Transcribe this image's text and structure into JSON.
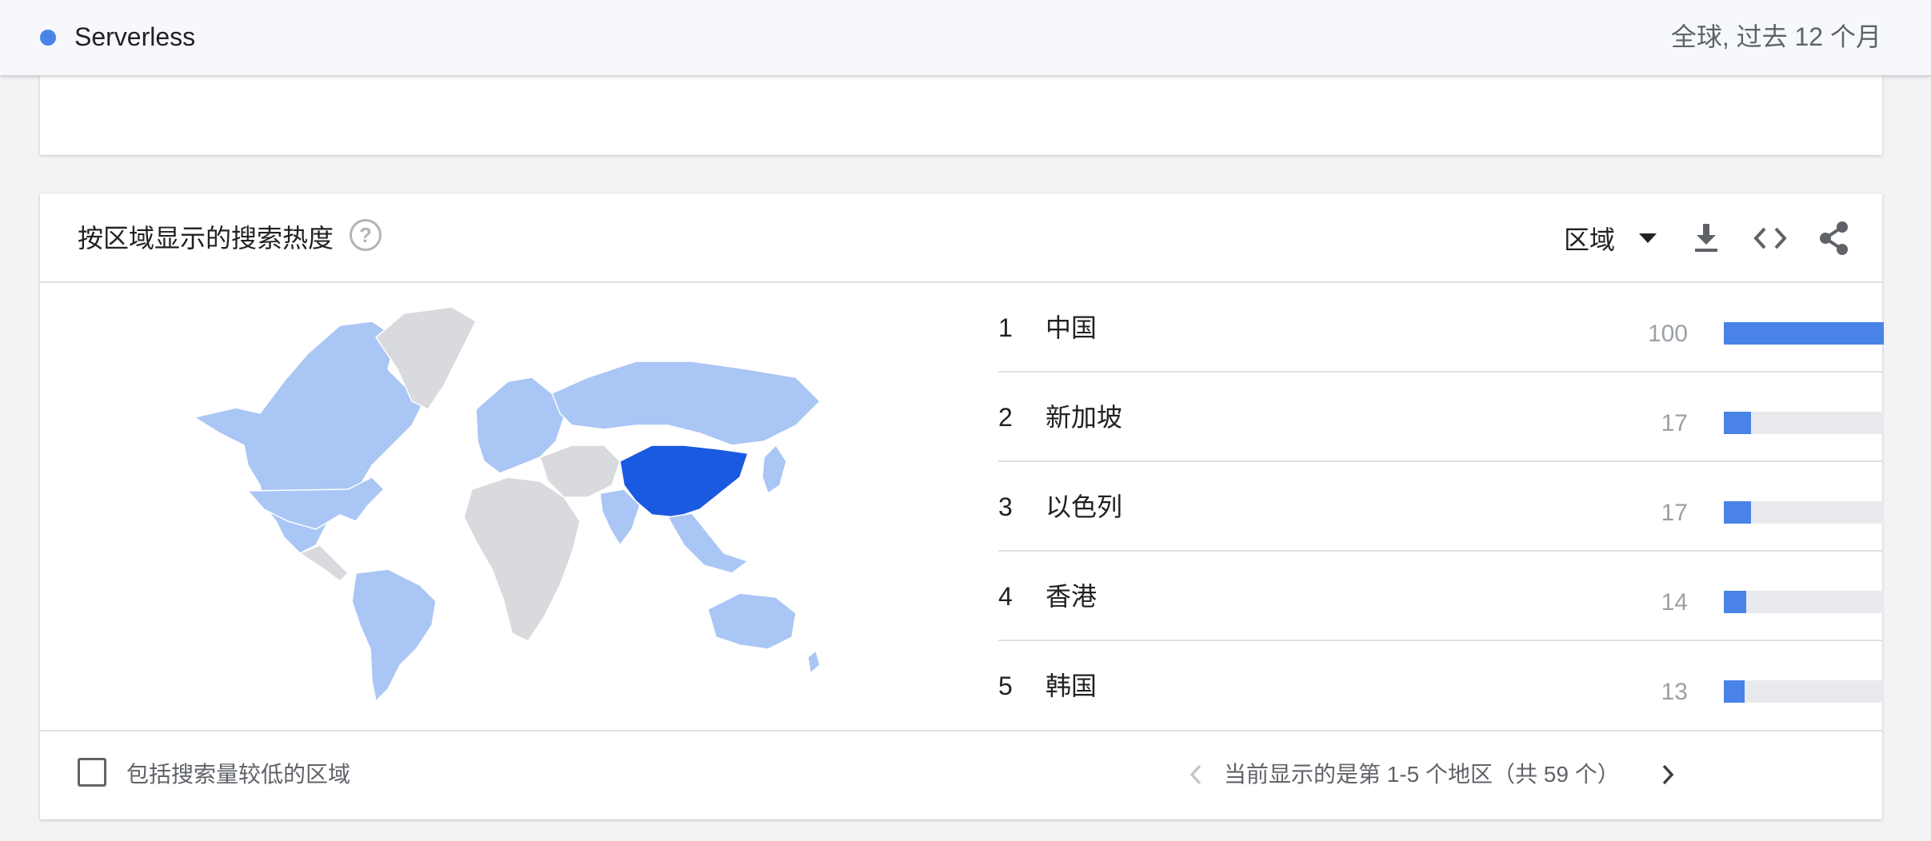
{
  "topbar": {
    "term": "Serverless",
    "scope": "全球, 过去 12 个月",
    "term_color": "#4a83e8"
  },
  "card": {
    "title": "按区域显示的搜索热度",
    "help_icon": "help-circle-icon",
    "region_select": "区域",
    "icons": [
      "download-icon",
      "embed-code-icon",
      "share-icon"
    ]
  },
  "map": {
    "colors": {
      "max": "#1a5ae0",
      "some": "#a9c6f5",
      "none": "#d8dadd"
    }
  },
  "ranking": {
    "rows": [
      {
        "rank": "1",
        "region": "中国",
        "value": "100",
        "fraction": 1.0
      },
      {
        "rank": "2",
        "region": "新加坡",
        "value": "17",
        "fraction": 0.17
      },
      {
        "rank": "3",
        "region": "以色列",
        "value": "17",
        "fraction": 0.17
      },
      {
        "rank": "4",
        "region": "香港",
        "value": "14",
        "fraction": 0.14
      },
      {
        "rank": "5",
        "region": "韩国",
        "value": "13",
        "fraction": 0.13
      }
    ]
  },
  "footer": {
    "checkbox_label": "包括搜索量较低的区域",
    "checked": false,
    "pager_text": "当前显示的是第 1-5 个地区（共 59 个）"
  }
}
